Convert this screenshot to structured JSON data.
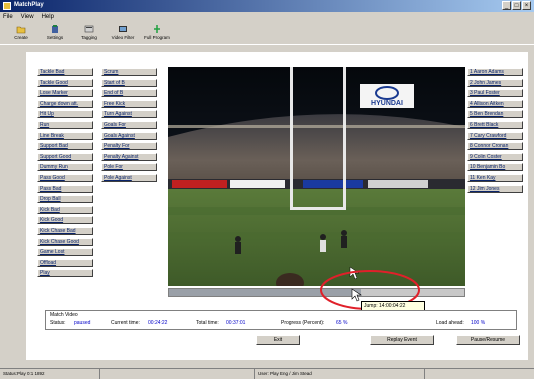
{
  "window": {
    "title": "MatchPlay"
  },
  "menu": [
    "File",
    "View",
    "Help"
  ],
  "toolbar": [
    {
      "label": "Create",
      "icon": "folder-icon"
    },
    {
      "label": "Settings",
      "icon": "settings-icon"
    },
    {
      "label": "Tagging",
      "icon": "tag-icon"
    },
    {
      "label": "Video Filter",
      "icon": "filter-icon"
    },
    {
      "label": "Full Program",
      "icon": "program-icon"
    }
  ],
  "left_buttons_col1": [
    "Tackle Bad",
    "Tackle Good",
    "Lose Marker",
    "Charge down att.",
    "Hit Up",
    "Run",
    "Line Break",
    "Support Bad",
    "Support Good",
    "Dummy Run",
    "Pass Good",
    "Pass Bad",
    "Drop Ball",
    "Kick Bad",
    "Kick Good",
    "Kick Chase Bad",
    "Kick Chase Good",
    "Game Lost",
    "Offload",
    "Play"
  ],
  "left_buttons_col2": [
    "Scrum",
    "Start of B",
    "End of B",
    "Free Kick",
    "Turn Against",
    "Goals For",
    "Goals Against",
    "Penalty For",
    "Penalty Against",
    "Pole For",
    "Pole Against"
  ],
  "players": [
    "1 Aaron Adams",
    "2 John James",
    "3 Paul Foster",
    "4 Allison Aitken",
    "5 Ben Brendan",
    "6 Brett Black",
    "7 Cary Crawford",
    "8 Connor Cronan",
    "9 Colin Coster",
    "10 Benjamin Bo",
    "11 Ken Kay",
    "12 Jim Jones"
  ],
  "status": {
    "label_match": "Match Video",
    "label_status": "Status:",
    "value_status": "paused",
    "label_current": "Current time:",
    "value_current": "00:24:22",
    "label_total": "Total time:",
    "value_total": "00:37:01",
    "label_progress": "Progress (Percent):",
    "value_progress": "65 %",
    "label_rate": "Load ahead:",
    "value_rate": "100 %"
  },
  "progress_fraction": 0.65,
  "tooltip": "Jump: 14:00:04:22",
  "bottom_buttons": {
    "exit": "Exit",
    "reset": "Replay Event",
    "pause": "Pause/Resume"
  },
  "statusbar": [
    "Status:Play 0:1 1892",
    "",
    "User: Play Eng / Jim Stead",
    ""
  ],
  "video": {
    "banner": "HYUNDAI"
  },
  "colors": {
    "titlebar": "#0a246a",
    "highlight_circle": "#e0202a"
  }
}
